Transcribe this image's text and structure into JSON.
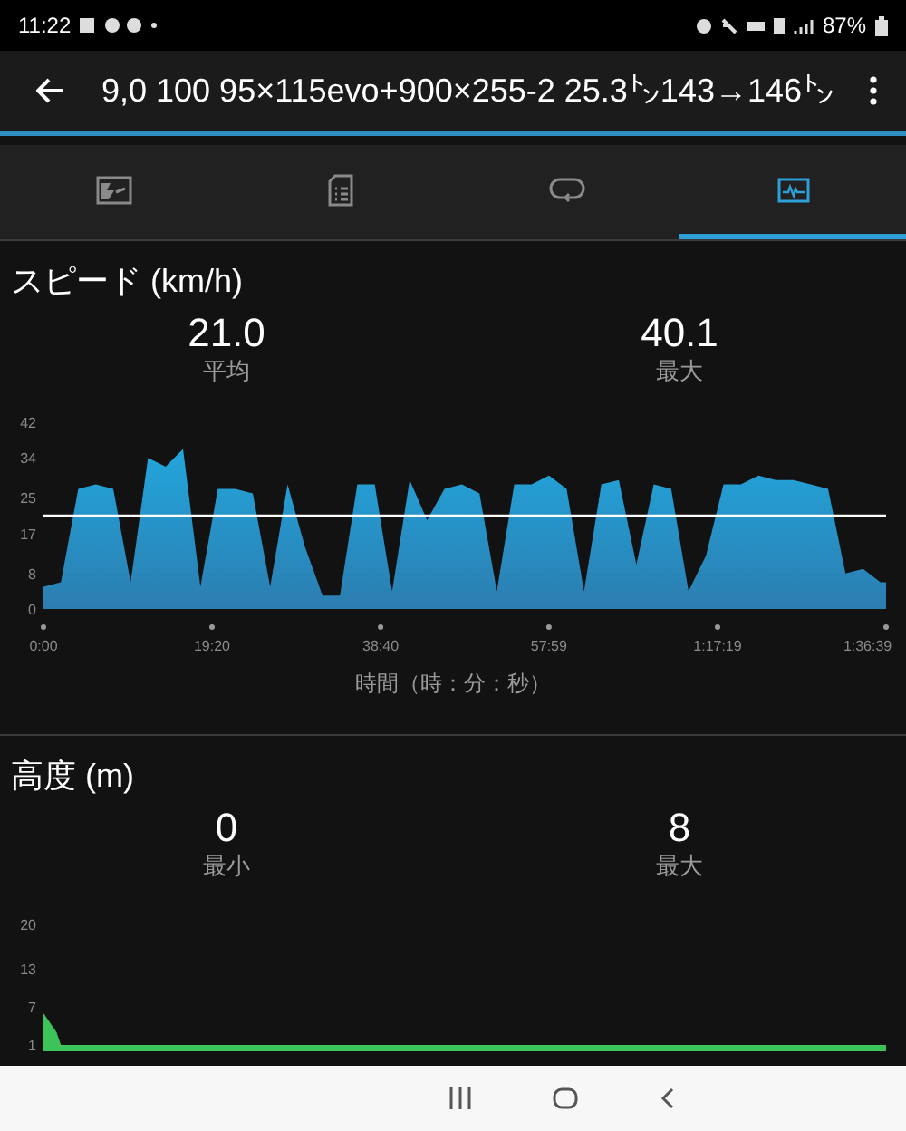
{
  "status_bar": {
    "time": "11:22",
    "battery": "87%"
  },
  "app_bar": {
    "title": "9,0 100 95×115evo+900×255-2 25.3㌧143→146㌧"
  },
  "tabs": [
    {
      "kind": "overview",
      "selected": false
    },
    {
      "kind": "details",
      "selected": false
    },
    {
      "kind": "laps",
      "selected": false
    },
    {
      "kind": "charts",
      "selected": true
    }
  ],
  "speed": {
    "title": "スピード (km/h)",
    "stats": [
      {
        "value": "21.0",
        "label": "平均"
      },
      {
        "value": "40.1",
        "label": "最大"
      }
    ],
    "chart_data": {
      "type": "area",
      "xlabel": "時間（時：分：秒）",
      "ylim": [
        0,
        42
      ],
      "xlim": [
        0,
        96.65
      ],
      "yticks": [
        0,
        8,
        17,
        25,
        34,
        42
      ],
      "xticks": [
        {
          "value": 0,
          "label": "0:00"
        },
        {
          "value": 19.33,
          "label": "19:20"
        },
        {
          "value": 38.67,
          "label": "38:40"
        },
        {
          "value": 57.98,
          "label": "57:59"
        },
        {
          "value": 77.32,
          "label": "1:17:19"
        },
        {
          "value": 96.65,
          "label": "1:36:39"
        }
      ],
      "x": [
        0,
        2,
        4,
        6,
        8,
        10,
        12,
        14,
        16,
        18,
        20,
        22,
        24,
        26,
        28,
        30,
        32,
        34,
        36,
        38,
        40,
        42,
        44,
        46,
        48,
        50,
        52,
        54,
        56,
        58,
        60,
        62,
        64,
        66,
        68,
        70,
        72,
        74,
        76,
        78,
        80,
        82,
        84,
        86,
        88,
        90,
        92,
        94,
        96,
        96.65
      ],
      "series": [
        {
          "color": "#22a6dc",
          "values": [
            5,
            6,
            27,
            28,
            27,
            6,
            34,
            32,
            36,
            5,
            27,
            27,
            26,
            5,
            28,
            14,
            3,
            3,
            28,
            28,
            4,
            29,
            20,
            27,
            28,
            26,
            4,
            28,
            28,
            30,
            27,
            4,
            28,
            29,
            10,
            28,
            27,
            4,
            12,
            28,
            28,
            30,
            29,
            29,
            28,
            27,
            8,
            9,
            6,
            6
          ]
        }
      ],
      "ref_lines": [
        {
          "axis": "y",
          "value": 21.0
        }
      ]
    }
  },
  "altitude": {
    "title": "高度 (m)",
    "stats": [
      {
        "value": "0",
        "label": "最小"
      },
      {
        "value": "8",
        "label": "最大"
      }
    ],
    "chart_data": {
      "type": "area",
      "yticks": [
        1,
        7,
        13,
        20
      ],
      "ylim": [
        0,
        20
      ],
      "xlim": [
        0,
        96.65
      ],
      "x": [
        0,
        0.5,
        1,
        1.5,
        2,
        3,
        10,
        20,
        30,
        40,
        50,
        60,
        70,
        80,
        90,
        96.65
      ],
      "series": [
        {
          "color": "#3cc35a",
          "values": [
            6,
            5,
            4,
            3,
            1,
            1,
            1,
            1,
            1,
            1,
            1,
            1,
            1,
            1,
            1,
            1
          ]
        }
      ]
    }
  }
}
